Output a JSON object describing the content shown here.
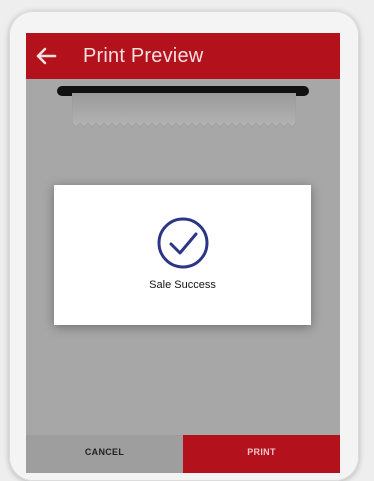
{
  "appbar": {
    "title": "Print Preview",
    "back_icon": "arrow-left-icon"
  },
  "dialog": {
    "icon": "check-circle-icon",
    "message": "Sale Success"
  },
  "actions": {
    "cancel_label": "CANCEL",
    "print_label": "PRINT"
  },
  "colors": {
    "accent": "#b3121c",
    "icon": "#2b3686",
    "overlay": "#a7a7a7"
  }
}
